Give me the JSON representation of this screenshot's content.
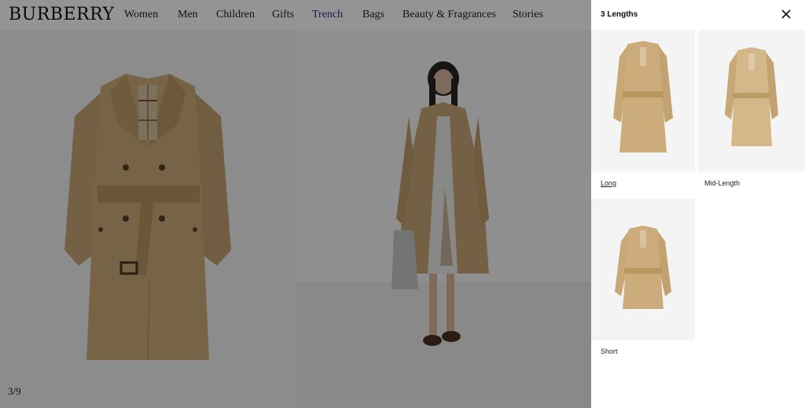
{
  "brand": {
    "logo": "BURBERRY"
  },
  "nav": {
    "items": [
      {
        "label": "Women"
      },
      {
        "label": "Men"
      },
      {
        "label": "Children"
      },
      {
        "label": "Gifts"
      },
      {
        "label": "Trench",
        "active": true
      },
      {
        "label": "Bags"
      },
      {
        "label": "Beauty & Fragrances"
      },
      {
        "label": "Stories"
      }
    ],
    "active_color": "#2b2c8c"
  },
  "gallery": {
    "counter": "3/9"
  },
  "drawer": {
    "title": "3 Lengths",
    "close_icon": "close-icon",
    "options": [
      {
        "label": "Long",
        "selected": true
      },
      {
        "label": "Mid-Length",
        "selected": false
      },
      {
        "label": "Short",
        "selected": false
      }
    ]
  },
  "colors": {
    "coat": "#c9a877",
    "coat_shadow": "#a9895b",
    "overlay": "rgba(0,0,0,0.42)"
  }
}
